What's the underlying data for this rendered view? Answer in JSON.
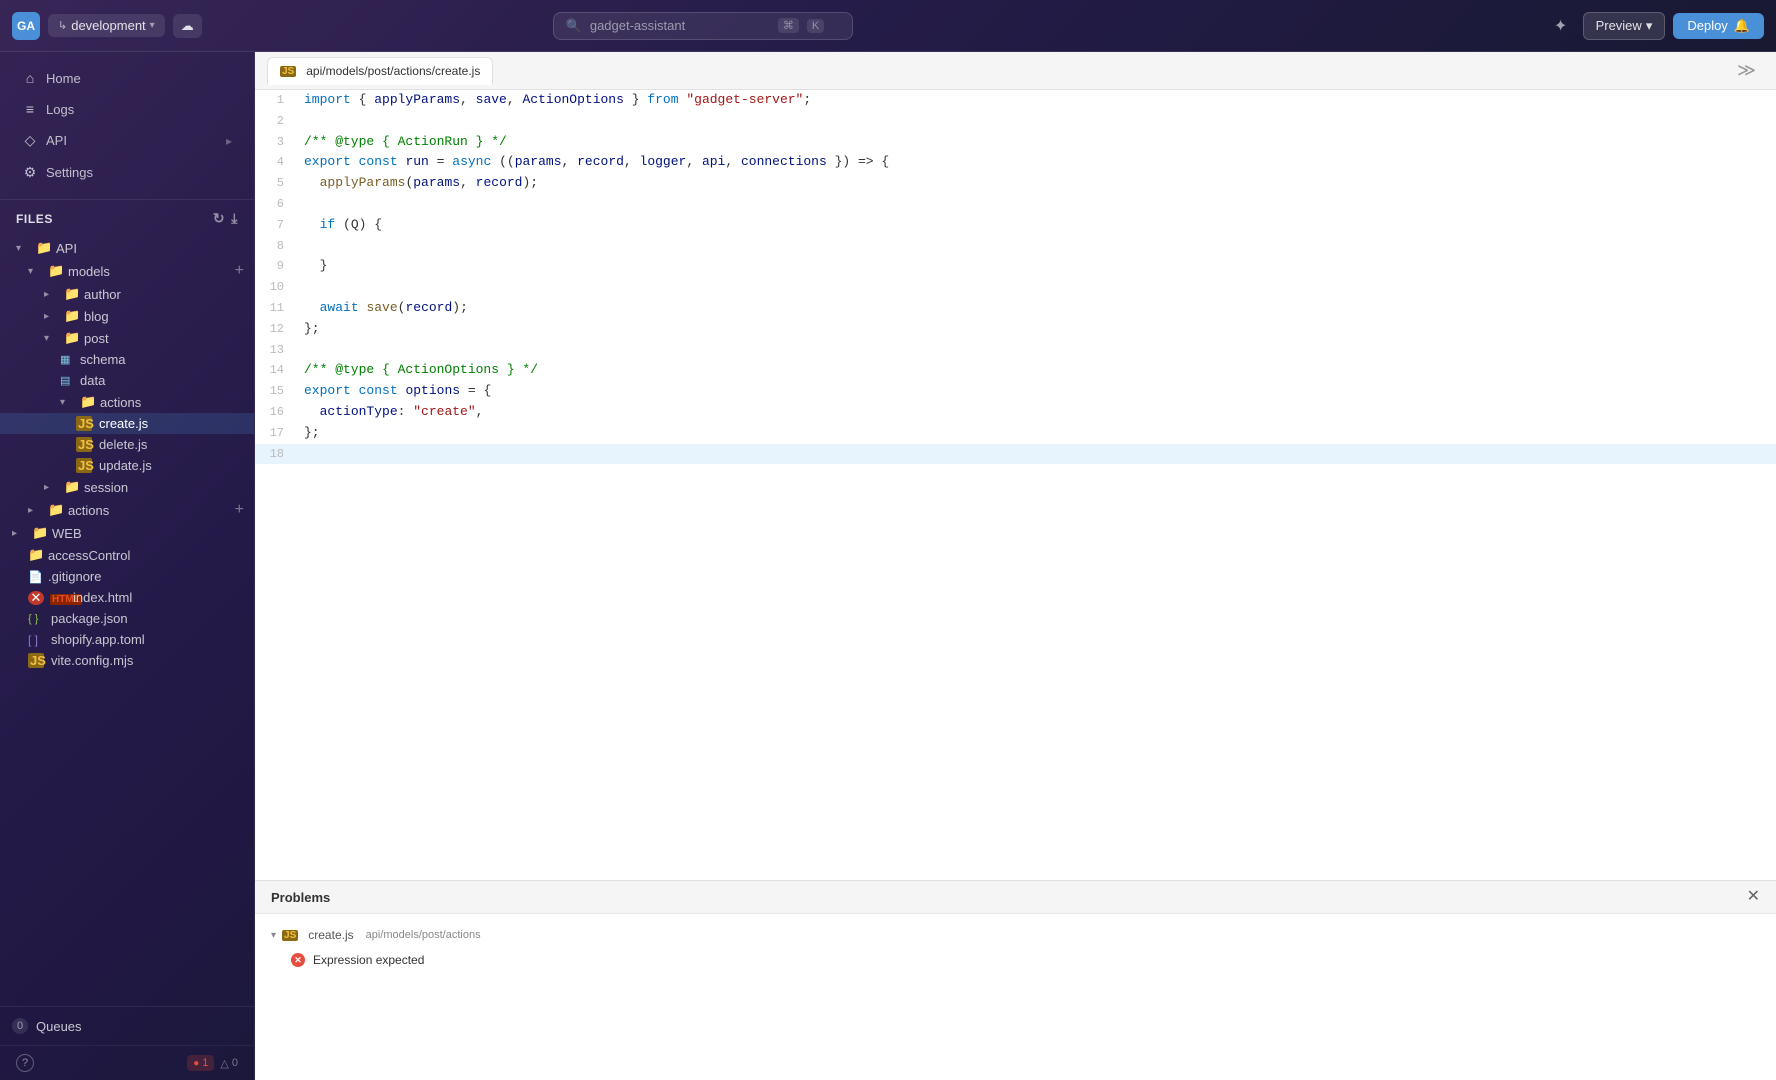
{
  "app": {
    "title": "gadget-assistant",
    "logo_text": "GA"
  },
  "topbar": {
    "branch_icon": "↳",
    "branch_label": "development",
    "branch_arrow": "▾",
    "cloud_icon": "☁",
    "search_placeholder": "gadget-assistant",
    "kbd1": "⌘",
    "kbd2": "K",
    "star_icon": "✦",
    "preview_label": "Preview",
    "preview_arrow": "▾",
    "deploy_label": "Deploy",
    "deploy_icon": "🔔"
  },
  "sidebar": {
    "nav_items": [
      {
        "icon": "⌂",
        "label": "Home"
      },
      {
        "icon": "≡",
        "label": "Logs"
      },
      {
        "icon": "◇",
        "label": "API"
      },
      {
        "icon": "⚙",
        "label": "Settings"
      }
    ],
    "files_header": "Files",
    "refresh_icon": "↻",
    "download_icon": "⤓",
    "tree": [
      {
        "type": "folder",
        "label": "API",
        "depth": 0,
        "expanded": true,
        "has_caret": true
      },
      {
        "type": "folder",
        "label": "models",
        "depth": 1,
        "expanded": true,
        "has_plus": true
      },
      {
        "type": "folder",
        "label": "author",
        "depth": 2,
        "expanded": false
      },
      {
        "type": "folder",
        "label": "blog",
        "depth": 2,
        "expanded": false
      },
      {
        "type": "folder",
        "label": "post",
        "depth": 2,
        "expanded": true
      },
      {
        "type": "file",
        "file_type": "schema",
        "label": "schema",
        "depth": 3
      },
      {
        "type": "file",
        "file_type": "data",
        "label": "data",
        "depth": 3
      },
      {
        "type": "folder",
        "label": "actions",
        "depth": 3,
        "expanded": true
      },
      {
        "type": "file",
        "file_type": "js",
        "label": "create.js",
        "depth": 4,
        "active": true
      },
      {
        "type": "file",
        "file_type": "js",
        "label": "delete.js",
        "depth": 4
      },
      {
        "type": "file",
        "file_type": "js",
        "label": "update.js",
        "depth": 4
      },
      {
        "type": "folder",
        "label": "session",
        "depth": 2,
        "expanded": false
      },
      {
        "type": "folder",
        "label": "actions",
        "depth": 1,
        "has_plus": true
      },
      {
        "type": "folder",
        "label": "WEB",
        "depth": 0,
        "expanded": false,
        "has_caret": true
      },
      {
        "type": "file",
        "file_type": "folder",
        "label": "accessControl",
        "depth": 1
      },
      {
        "type": "file",
        "file_type": "gitignore",
        "label": ".gitignore",
        "depth": 1
      },
      {
        "type": "file",
        "file_type": "html",
        "label": "index.html",
        "depth": 1,
        "has_error": true
      },
      {
        "type": "file",
        "file_type": "json",
        "label": "package.json",
        "depth": 1
      },
      {
        "type": "file",
        "file_type": "toml",
        "label": "shopify.app.toml",
        "depth": 1
      },
      {
        "type": "file",
        "file_type": "js",
        "label": "vite.config.mjs",
        "depth": 1
      }
    ],
    "queues_icon": "☰",
    "queues_label": "Queues",
    "queues_count": "0",
    "help_icon": "?",
    "error_count": "1",
    "warning_count": "0"
  },
  "editor": {
    "tab_label": "api/models/post/actions/create.js",
    "tab_js_badge": "JS",
    "lines": [
      {
        "num": 1,
        "tokens": [
          {
            "t": "kw",
            "v": "import"
          },
          {
            "t": "op",
            "v": " { "
          },
          {
            "t": "param",
            "v": "applyParams"
          },
          {
            "t": "op",
            "v": ", "
          },
          {
            "t": "param",
            "v": "save"
          },
          {
            "t": "op",
            "v": ", "
          },
          {
            "t": "param",
            "v": "ActionOptions"
          },
          {
            "t": "op",
            "v": " } "
          },
          {
            "t": "kw",
            "v": "from"
          },
          {
            "t": "op",
            "v": " "
          },
          {
            "t": "str",
            "v": "\"gadget-server\""
          },
          {
            "t": "op",
            "v": ";"
          }
        ]
      },
      {
        "num": 2,
        "tokens": []
      },
      {
        "num": 3,
        "tokens": [
          {
            "t": "cm",
            "v": "/** @type { ActionRun } */"
          }
        ]
      },
      {
        "num": 4,
        "tokens": [
          {
            "t": "kw",
            "v": "export"
          },
          {
            "t": "op",
            "v": " "
          },
          {
            "t": "kw",
            "v": "const"
          },
          {
            "t": "op",
            "v": " "
          },
          {
            "t": "param",
            "v": "run"
          },
          {
            "t": "op",
            "v": " = "
          },
          {
            "t": "kw",
            "v": "async"
          },
          {
            "t": "op",
            "v": " (("
          },
          {
            "t": "param",
            "v": "params"
          },
          {
            "t": "op",
            "v": ", "
          },
          {
            "t": "param",
            "v": "record"
          },
          {
            "t": "op",
            "v": ", "
          },
          {
            "t": "param",
            "v": "logger"
          },
          {
            "t": "op",
            "v": ", "
          },
          {
            "t": "param",
            "v": "api"
          },
          {
            "t": "op",
            "v": ", "
          },
          {
            "t": "param",
            "v": "connections"
          },
          {
            "t": "op",
            "v": " }) => {"
          }
        ]
      },
      {
        "num": 5,
        "tokens": [
          {
            "t": "op",
            "v": "  "
          },
          {
            "t": "fn",
            "v": "applyParams"
          },
          {
            "t": "op",
            "v": "("
          },
          {
            "t": "param",
            "v": "params"
          },
          {
            "t": "op",
            "v": ", "
          },
          {
            "t": "param",
            "v": "record"
          },
          {
            "t": "op",
            "v": ");"
          }
        ]
      },
      {
        "num": 6,
        "tokens": []
      },
      {
        "num": 7,
        "tokens": [
          {
            "t": "op",
            "v": "  "
          },
          {
            "t": "kw",
            "v": "if"
          },
          {
            "t": "op",
            "v": " (Q) {"
          }
        ]
      },
      {
        "num": 8,
        "tokens": []
      },
      {
        "num": 9,
        "tokens": [
          {
            "t": "op",
            "v": "  }"
          }
        ]
      },
      {
        "num": 10,
        "tokens": []
      },
      {
        "num": 11,
        "tokens": [
          {
            "t": "op",
            "v": "  "
          },
          {
            "t": "kw",
            "v": "await"
          },
          {
            "t": "op",
            "v": " "
          },
          {
            "t": "fn",
            "v": "save"
          },
          {
            "t": "op",
            "v": "("
          },
          {
            "t": "param",
            "v": "record"
          },
          {
            "t": "op",
            "v": ");"
          }
        ]
      },
      {
        "num": 12,
        "tokens": [
          {
            "t": "op",
            "v": "};"
          }
        ]
      },
      {
        "num": 13,
        "tokens": []
      },
      {
        "num": 14,
        "tokens": [
          {
            "t": "cm",
            "v": "/** @type { ActionOptions } */"
          }
        ]
      },
      {
        "num": 15,
        "tokens": [
          {
            "t": "kw",
            "v": "export"
          },
          {
            "t": "op",
            "v": " "
          },
          {
            "t": "kw",
            "v": "const"
          },
          {
            "t": "op",
            "v": " "
          },
          {
            "t": "param",
            "v": "options"
          },
          {
            "t": "op",
            "v": " = {"
          }
        ]
      },
      {
        "num": 16,
        "tokens": [
          {
            "t": "op",
            "v": "  "
          },
          {
            "t": "param",
            "v": "actionType"
          },
          {
            "t": "op",
            "v": ": "
          },
          {
            "t": "str",
            "v": "\"create\""
          },
          {
            "t": "op",
            "v": ","
          }
        ]
      },
      {
        "num": 17,
        "tokens": [
          {
            "t": "op",
            "v": "};"
          }
        ]
      },
      {
        "num": 18,
        "tokens": []
      }
    ]
  },
  "problems": {
    "title": "Problems",
    "close_icon": "✕",
    "file_label": "create.js",
    "file_js_badge": "JS",
    "file_path": "api/models/post/actions",
    "error_label": "Expression expected",
    "error_icon": "✕"
  }
}
